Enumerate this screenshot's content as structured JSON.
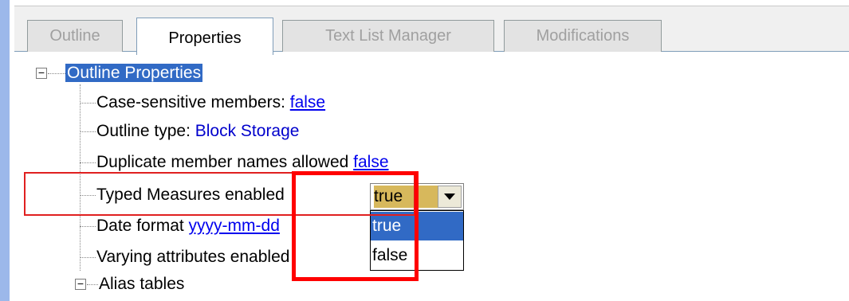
{
  "tabs": [
    {
      "label": "Outline",
      "active": false,
      "enabled": false
    },
    {
      "label": "Properties",
      "active": true,
      "enabled": true
    },
    {
      "label": "Text List Manager",
      "active": false,
      "enabled": false
    },
    {
      "label": "Modifications",
      "active": false,
      "enabled": false
    }
  ],
  "tree": {
    "root_label": "Outline Properties",
    "items": [
      {
        "label": "Case-sensitive members: ",
        "value": "false"
      },
      {
        "label": "Outline type: ",
        "value": "Block Storage"
      },
      {
        "label": "Duplicate member names allowed ",
        "value": "false"
      },
      {
        "label": "Typed Measures enabled"
      },
      {
        "label": "Date format ",
        "value": "yyyy-mm-dd"
      },
      {
        "label": "Varying attributes enabled"
      }
    ],
    "alias_label": "Alias tables"
  },
  "dropdown": {
    "selected": "true",
    "options": [
      "true",
      "false"
    ]
  },
  "colors": {
    "accent": "#316ac5",
    "highlight": "#ff0000",
    "link": "#0000ee",
    "combo_bg": "#d7b85c"
  }
}
